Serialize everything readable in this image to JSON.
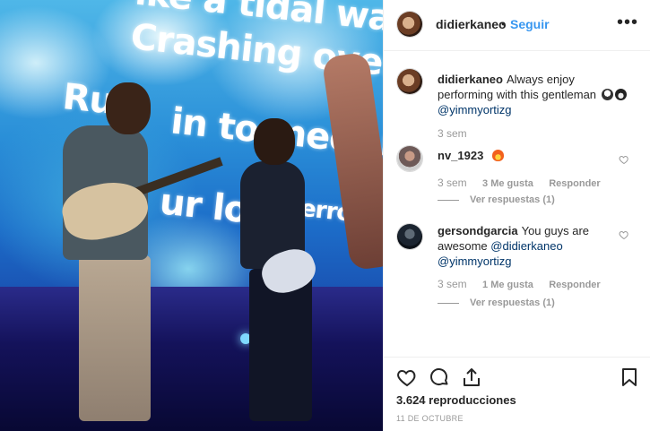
{
  "media": {
    "lyrics": [
      "ike a tidal wave",
      "Crashing over me",
      "Ru",
      "in to meet me",
      "ur love",
      "errorc"
    ]
  },
  "header": {
    "username": "didierkaneo",
    "separator": "•",
    "follow_label": "Seguir",
    "more_icon": "more-options-icon"
  },
  "caption": {
    "username": "didierkaneo",
    "text": "Always enjoy performing with this gentleman",
    "mention": "@yimmyortizg",
    "time": "3 sem"
  },
  "comments": [
    {
      "username": "nv_1923",
      "text": "",
      "time": "3 sem",
      "likes": "3 Me gusta",
      "reply_label": "Responder",
      "view_replies": "Ver respuestas (1)"
    },
    {
      "username": "gersondgarcia",
      "text": "You guys are awesome",
      "mentions": [
        "@didierkaneo",
        "@yimmyortizg"
      ],
      "time": "3 sem",
      "likes": "1 Me gusta",
      "reply_label": "Responder",
      "view_replies": "Ver respuestas (1)"
    }
  ],
  "actions": {
    "views": "3.624 reproducciones",
    "date": "11 DE OCTUBRE"
  },
  "colors": {
    "link_blue": "#3897f0",
    "mention": "#003569",
    "muted": "#999999",
    "text": "#262626",
    "border": "#efefef"
  }
}
